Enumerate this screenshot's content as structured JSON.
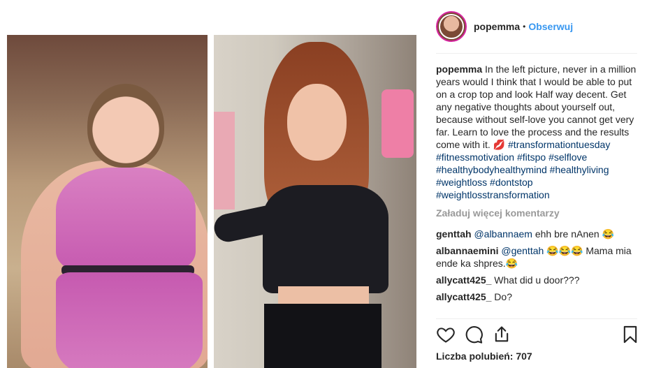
{
  "post": {
    "username": "popemma",
    "separator": "•",
    "follow_label": "Obserwuj"
  },
  "caption": {
    "username": "popemma",
    "text": "In the left picture, never in a million years would I think that I would be able to put on a crop top and look Half way decent. Get any negative thoughts about yourself out, because without self-love you cannot get very far. Learn to love the process and the results come with it. 💋",
    "hashtags": "#transformationtuesday #fitnessmotivation #fitspo #selflove #healthybodyhealthymind #healthyliving #weightloss #dontstop #weightlosstransformation"
  },
  "load_more_label": "Załaduj więcej komentarzy",
  "comments": [
    {
      "username": "genttah",
      "mention": "@albannaem",
      "text": "ehh bre nAnen 😂"
    },
    {
      "username": "albannaemini",
      "mention": "@genttah",
      "text": "😂😂😂 Mama mia ende ka shpres.😂"
    },
    {
      "username": "allycatt425_",
      "text": "What did u door???"
    },
    {
      "username": "allycatt425_",
      "text": "Do?"
    }
  ],
  "likes_label": "Liczba polubień: 707",
  "icons": [
    "heart-icon",
    "comment-icon",
    "share-icon",
    "bookmark-icon"
  ],
  "colors": {
    "link": "#3897f0",
    "hashtag": "#003569",
    "muted": "#999999",
    "avatar_ring": "#d6249f"
  }
}
